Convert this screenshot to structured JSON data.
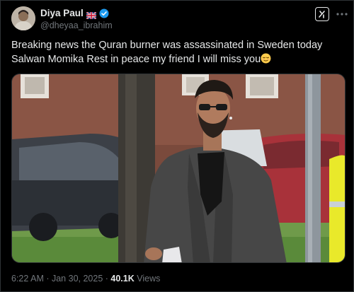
{
  "author": {
    "display_name": "Diya Paul",
    "flag_icon": "uk-flag-icon",
    "verified_icon": "verified-badge-icon",
    "handle": "@dheyaa_ibrahim"
  },
  "post": {
    "text_line_1": "Breaking news the Quran burner was assassinated in Sweden today",
    "text_line_2": "Salwan Momika Rest in peace my friend I will miss you",
    "emoji_icon": "relieved-face-emoji"
  },
  "meta": {
    "time": "6:22 AM",
    "sep1": " · ",
    "date": "Jan 30, 2025",
    "sep2": " · ",
    "views_count": "40.1K",
    "views_label": " Views"
  },
  "colors": {
    "background": "#000000",
    "text": "#e7e9ea",
    "secondary": "#71767b",
    "verified": "#1d9bf0"
  }
}
